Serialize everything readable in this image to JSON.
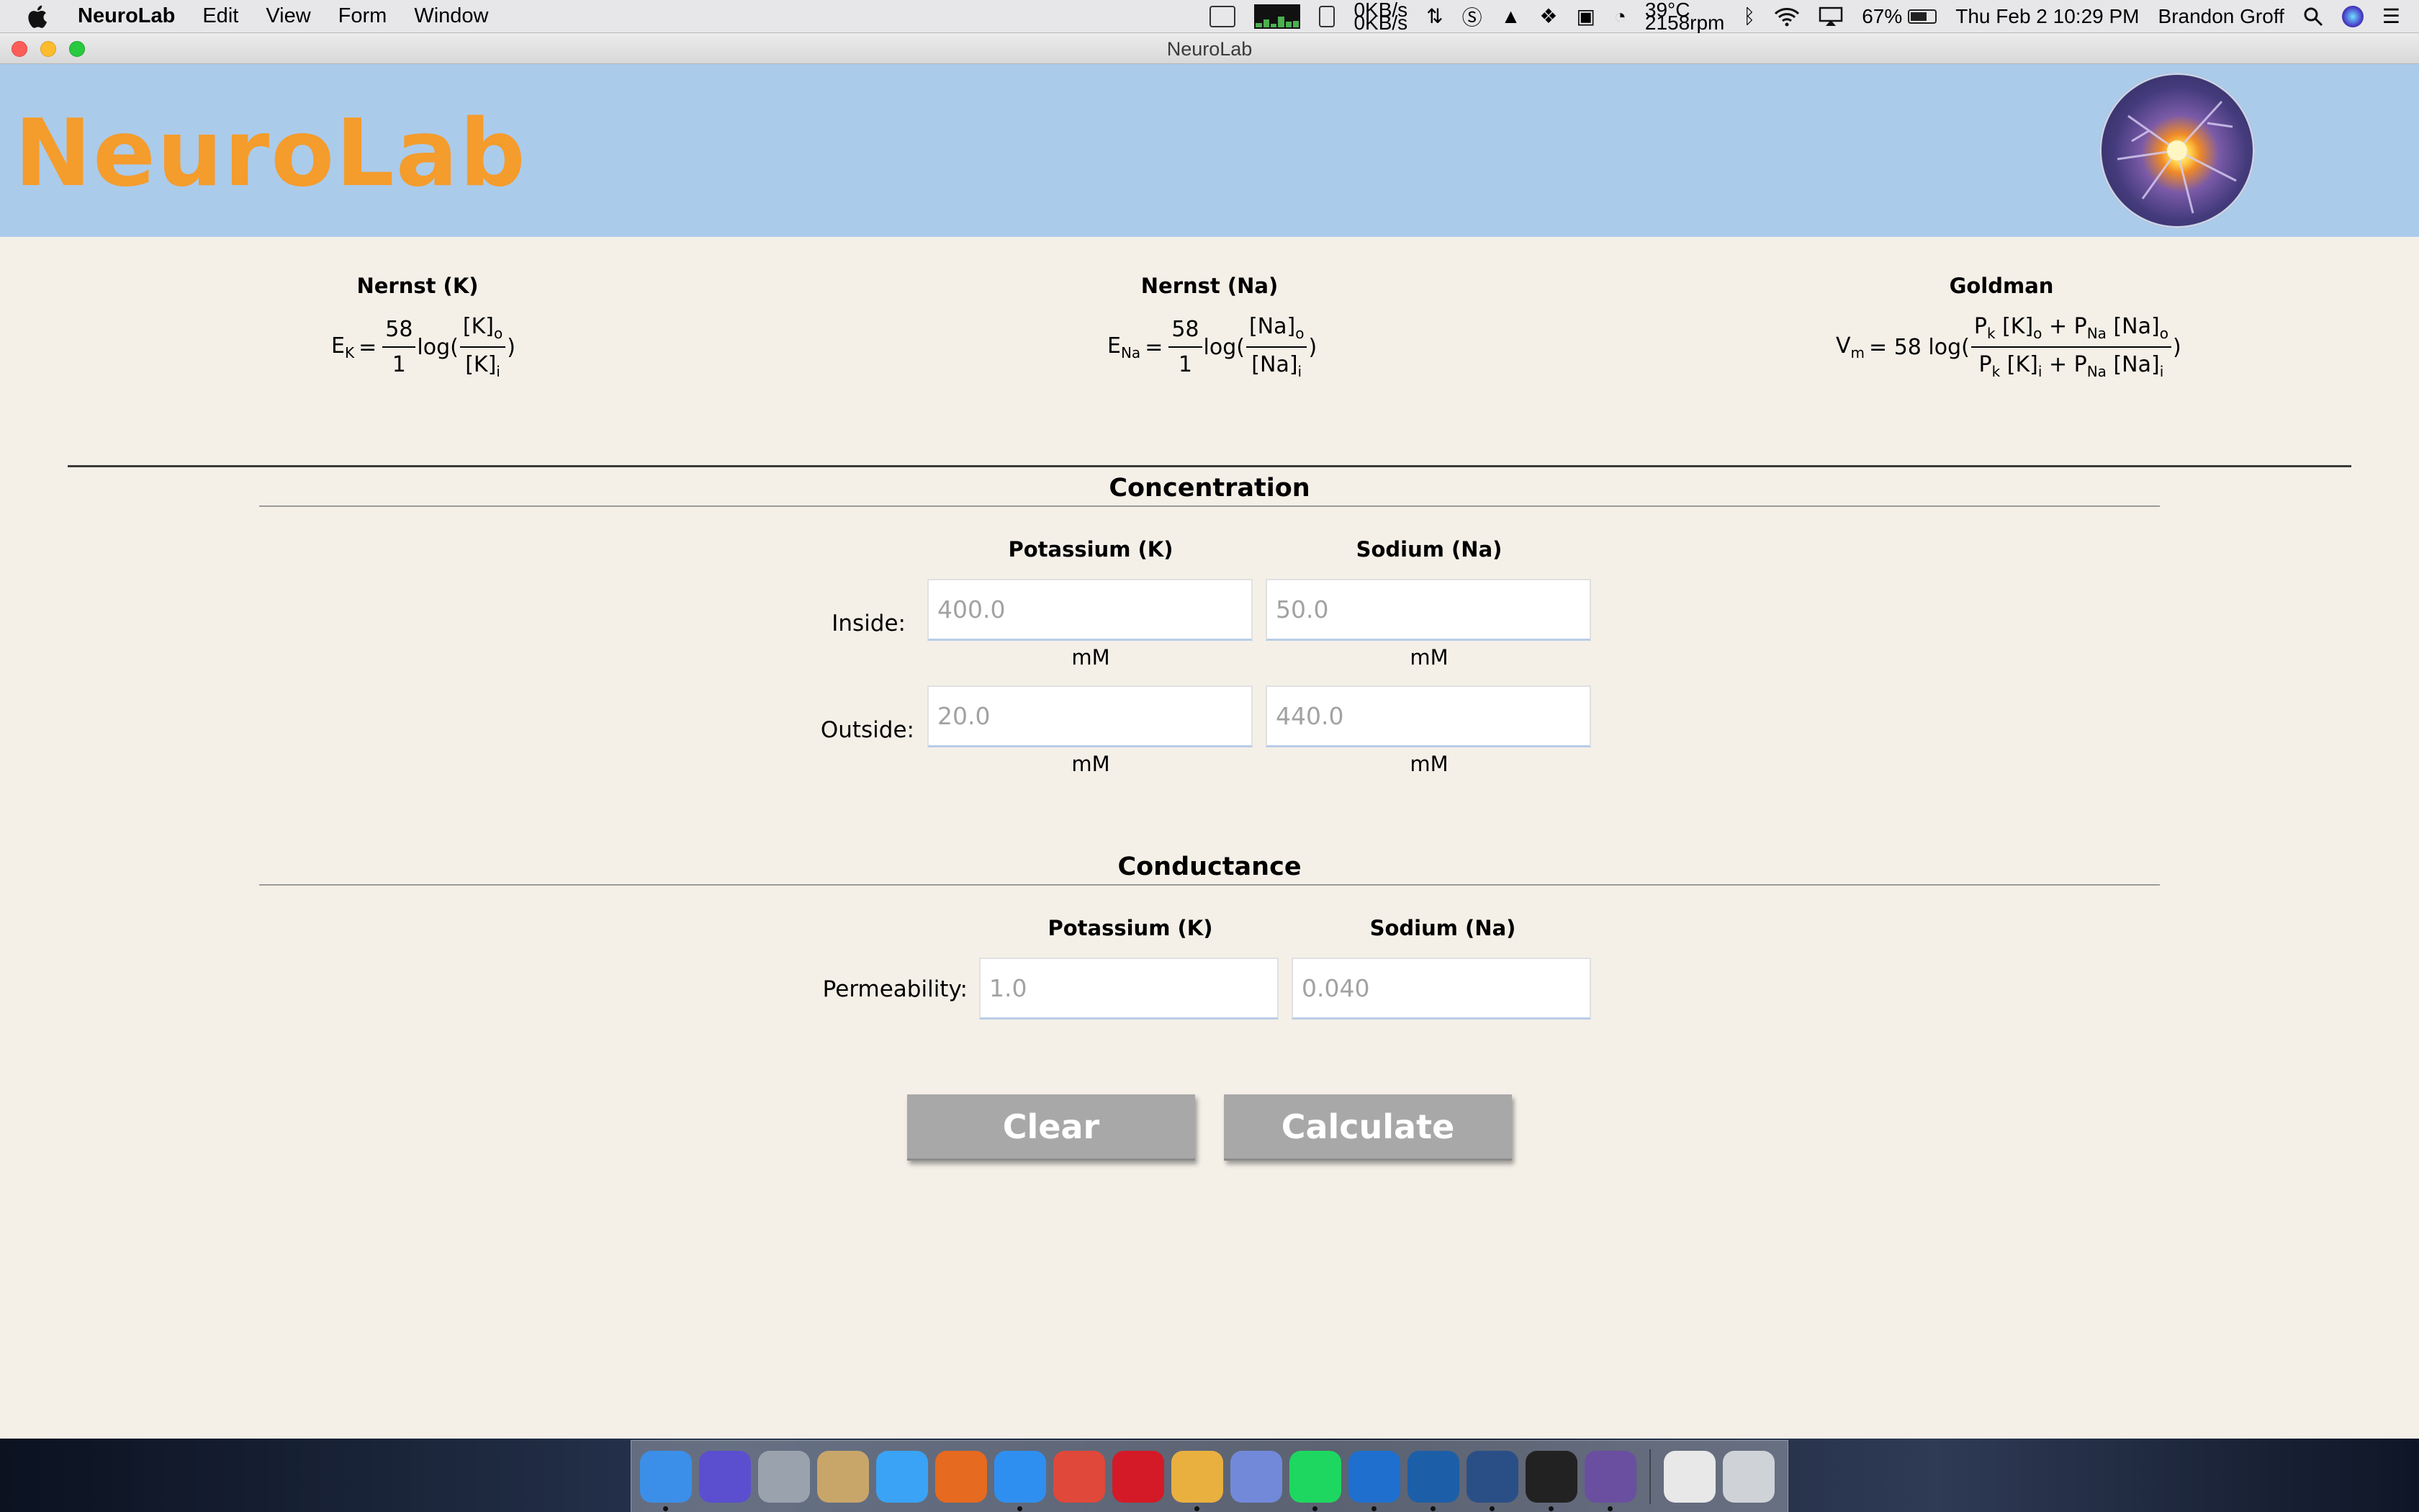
{
  "menubar": {
    "items": [
      "NeuroLab",
      "Edit",
      "View",
      "Form",
      "Window"
    ],
    "status": {
      "net_up": "0KB/s",
      "net_down": "0KB/s",
      "temperature": "39°C",
      "fan": "2158rpm",
      "battery": "67%",
      "datetime": "Thu Feb 2  10:29 PM",
      "user": "Brandon Groff"
    }
  },
  "window": {
    "title": "NeuroLab",
    "brand": "NeuroLab"
  },
  "formulas": {
    "nernst_k": {
      "title": "Nernst (K)",
      "lhs_base": "E",
      "lhs_sub": "K",
      "equals": "=",
      "numerator": "58",
      "denominator": "1",
      "log": "log(",
      "close": ")",
      "frac_num_base": "[K]",
      "frac_num_sub": "o",
      "frac_den_base": "[K]",
      "frac_den_sub": "i"
    },
    "nernst_na": {
      "title": "Nernst (Na)",
      "lhs_base": "E",
      "lhs_sub": "Na",
      "equals": "=",
      "numerator": "58",
      "denominator": "1",
      "log": "log(",
      "close": ")",
      "frac_num_base": "[Na]",
      "frac_num_sub": "o",
      "frac_den_base": "[Na]",
      "frac_den_sub": "i"
    },
    "goldman": {
      "title": "Goldman",
      "lhs_base": "V",
      "lhs_sub": "m",
      "rhs_prefix": "= 58 log(",
      "close": ")",
      "num_p1": "P",
      "num_p1_sub": "k",
      "num_c1": " [K]",
      "num_c1_sub": "o",
      "num_plus": " + P",
      "num_p2_sub": "Na",
      "num_c2": " [Na]",
      "num_c2_sub": "o",
      "den_p1": "P",
      "den_p1_sub": "k",
      "den_c1": " [K]",
      "den_c1_sub": "i",
      "den_plus": " + P",
      "den_p2_sub": "Na",
      "den_c2": " [Na]",
      "den_c2_sub": "i"
    }
  },
  "concentration": {
    "title": "Concentration",
    "col_k": "Potassium (K)",
    "col_na": "Sodium (Na)",
    "inside_label": "Inside:",
    "outside_label": "Outside:",
    "unit": "mM",
    "inside_k_placeholder": "400.0",
    "inside_na_placeholder": "50.0",
    "outside_k_placeholder": "20.0",
    "outside_na_placeholder": "440.0"
  },
  "conductance": {
    "title": "Conductance",
    "col_k": "Potassium (K)",
    "col_na": "Sodium (Na)",
    "permeability_label": "Permeability:",
    "perm_k_placeholder": "1.0",
    "perm_na_placeholder": "0.040"
  },
  "buttons": {
    "clear": "Clear",
    "calculate": "Calculate"
  },
  "dock": {
    "apps": [
      {
        "name": "finder-icon",
        "color": "#3b8fe8",
        "running": true
      },
      {
        "name": "siri-icon",
        "color": "#5b4fd0",
        "running": false
      },
      {
        "name": "launchpad-icon",
        "color": "#9aa3ad",
        "running": false
      },
      {
        "name": "preview-icon",
        "color": "#c8a66a",
        "running": false
      },
      {
        "name": "messages-icon",
        "color": "#3aa3f5",
        "running": false
      },
      {
        "name": "firefox-icon",
        "color": "#e66a1f",
        "running": false
      },
      {
        "name": "safari-icon",
        "color": "#2f8ff0",
        "running": true
      },
      {
        "name": "chrome-icon",
        "color": "#e0483a",
        "running": false
      },
      {
        "name": "opera-icon",
        "color": "#d41a26",
        "running": false
      },
      {
        "name": "slack-icon",
        "color": "#e9b03f",
        "running": true
      },
      {
        "name": "discord-icon",
        "color": "#7289da",
        "running": false
      },
      {
        "name": "spotify-icon",
        "color": "#1ed760",
        "running": true
      },
      {
        "name": "teamviewer-icon",
        "color": "#1f6fcf",
        "running": true
      },
      {
        "name": "sourcetree-icon",
        "color": "#1c5fa8",
        "running": true
      },
      {
        "name": "git-tree-icon",
        "color": "#2a4f86",
        "running": true
      },
      {
        "name": "terminal-icon",
        "color": "#222222",
        "running": true
      },
      {
        "name": "neurolab-app-icon",
        "color": "#6a4fa0",
        "running": true
      }
    ],
    "extras": [
      {
        "name": "documents-stack-icon",
        "color": "#e8e8e8"
      },
      {
        "name": "trash-icon",
        "color": "#cfd3d8"
      }
    ]
  }
}
